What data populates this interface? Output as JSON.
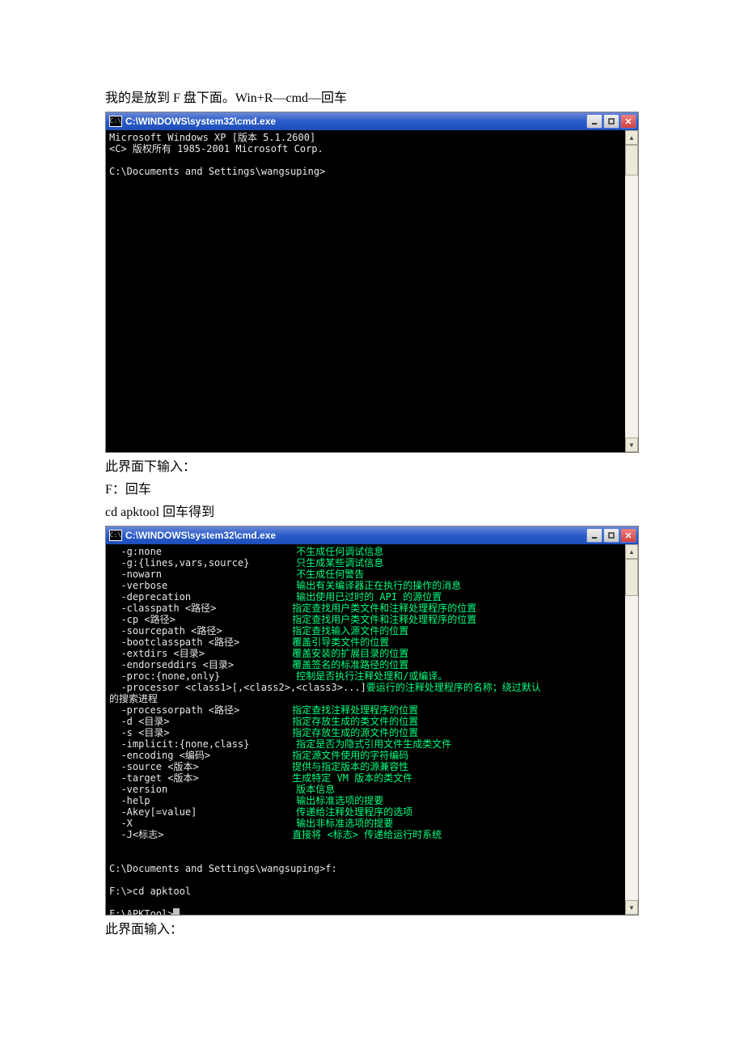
{
  "doc": {
    "p1": "我的是放到 F 盘下面。Win+R—cmd—回车",
    "p2": "此界面下输入：",
    "p3": "F：回车",
    "p4": "cd apktool 回车得到",
    "p5": "此界面输入："
  },
  "window1": {
    "title": "C:\\WINDOWS\\system32\\cmd.exe",
    "icon_text": "C:\\",
    "lines": {
      "l1": "Microsoft Windows XP [版本 5.1.2600]",
      "l2": "<C> 版权所有 1985-2001 Microsoft Corp.",
      "l3": "",
      "l4": "C:\\Documents and Settings\\wangsuping>"
    }
  },
  "window2": {
    "title": "C:\\WINDOWS\\system32\\cmd.exe",
    "icon_text": "C:\\",
    "options": [
      {
        "flag": "  -g:none",
        "desc": "不生成任何调试信息"
      },
      {
        "flag": "  -g:{lines,vars,source}",
        "desc": "只生成某些调试信息"
      },
      {
        "flag": "  -nowarn",
        "desc": "不生成任何警告"
      },
      {
        "flag": "  -verbose",
        "desc": "输出有关编译器正在执行的操作的消息"
      },
      {
        "flag": "  -deprecation",
        "desc": "输出使用已过时的 API 的源位置"
      },
      {
        "flag": "  -classpath <路径>",
        "desc": "指定查找用户类文件和注释处理程序的位置"
      },
      {
        "flag": "  -cp <路径>",
        "desc": "指定查找用户类文件和注释处理程序的位置"
      },
      {
        "flag": "  -sourcepath <路径>",
        "desc": "指定查找输入源文件的位置"
      },
      {
        "flag": "  -bootclasspath <路径>",
        "desc": "覆盖引导类文件的位置"
      },
      {
        "flag": "  -extdirs <目录>",
        "desc": "覆盖安装的扩展目录的位置"
      },
      {
        "flag": "  -endorseddirs <目录>",
        "desc": "覆盖签名的标准路径的位置"
      },
      {
        "flag": "  -proc:{none,only}",
        "desc": "控制是否执行注释处理和/或编译。"
      }
    ],
    "processor_line_flag": "  -processor <class1>[,<class2>,<class3>...]",
    "processor_line_desc": "要运行的注释处理程序的名称；绕过默认",
    "search_line": "的搜索进程",
    "options2": [
      {
        "flag": "  -processorpath <路径>",
        "desc": "指定查找注释处理程序的位置"
      },
      {
        "flag": "  -d <目录>",
        "desc": "指定存放生成的类文件的位置"
      },
      {
        "flag": "  -s <目录>",
        "desc": "指定存放生成的源文件的位置"
      },
      {
        "flag": "  -implicit:{none,class}",
        "desc": "指定是否为隐式引用文件生成类文件"
      },
      {
        "flag": "  -encoding <编码>",
        "desc": "指定源文件使用的字符编码"
      },
      {
        "flag": "  -source <版本>",
        "desc": "提供与指定版本的源兼容性"
      },
      {
        "flag": "  -target <版本>",
        "desc": "生成特定 VM 版本的类文件"
      },
      {
        "flag": "  -version",
        "desc": "版本信息"
      },
      {
        "flag": "  -help",
        "desc": "输出标准选项的提要"
      },
      {
        "flag": "  -Akey[=value]",
        "desc": "传递给注释处理程序的选项"
      },
      {
        "flag": "  -X",
        "desc": "输出非标准选项的提要"
      },
      {
        "flag": "  -J<标志>",
        "desc": "直接将 <标志> 传递给运行时系统"
      }
    ],
    "tail": {
      "t1": "C:\\Documents and Settings\\wangsuping>f:",
      "t2": "F:\\>cd apktool",
      "t3": "F:\\APKTool>"
    }
  },
  "controls": {
    "min": "_",
    "max": "□",
    "close": "×",
    "up": "▲",
    "down": "▼"
  }
}
